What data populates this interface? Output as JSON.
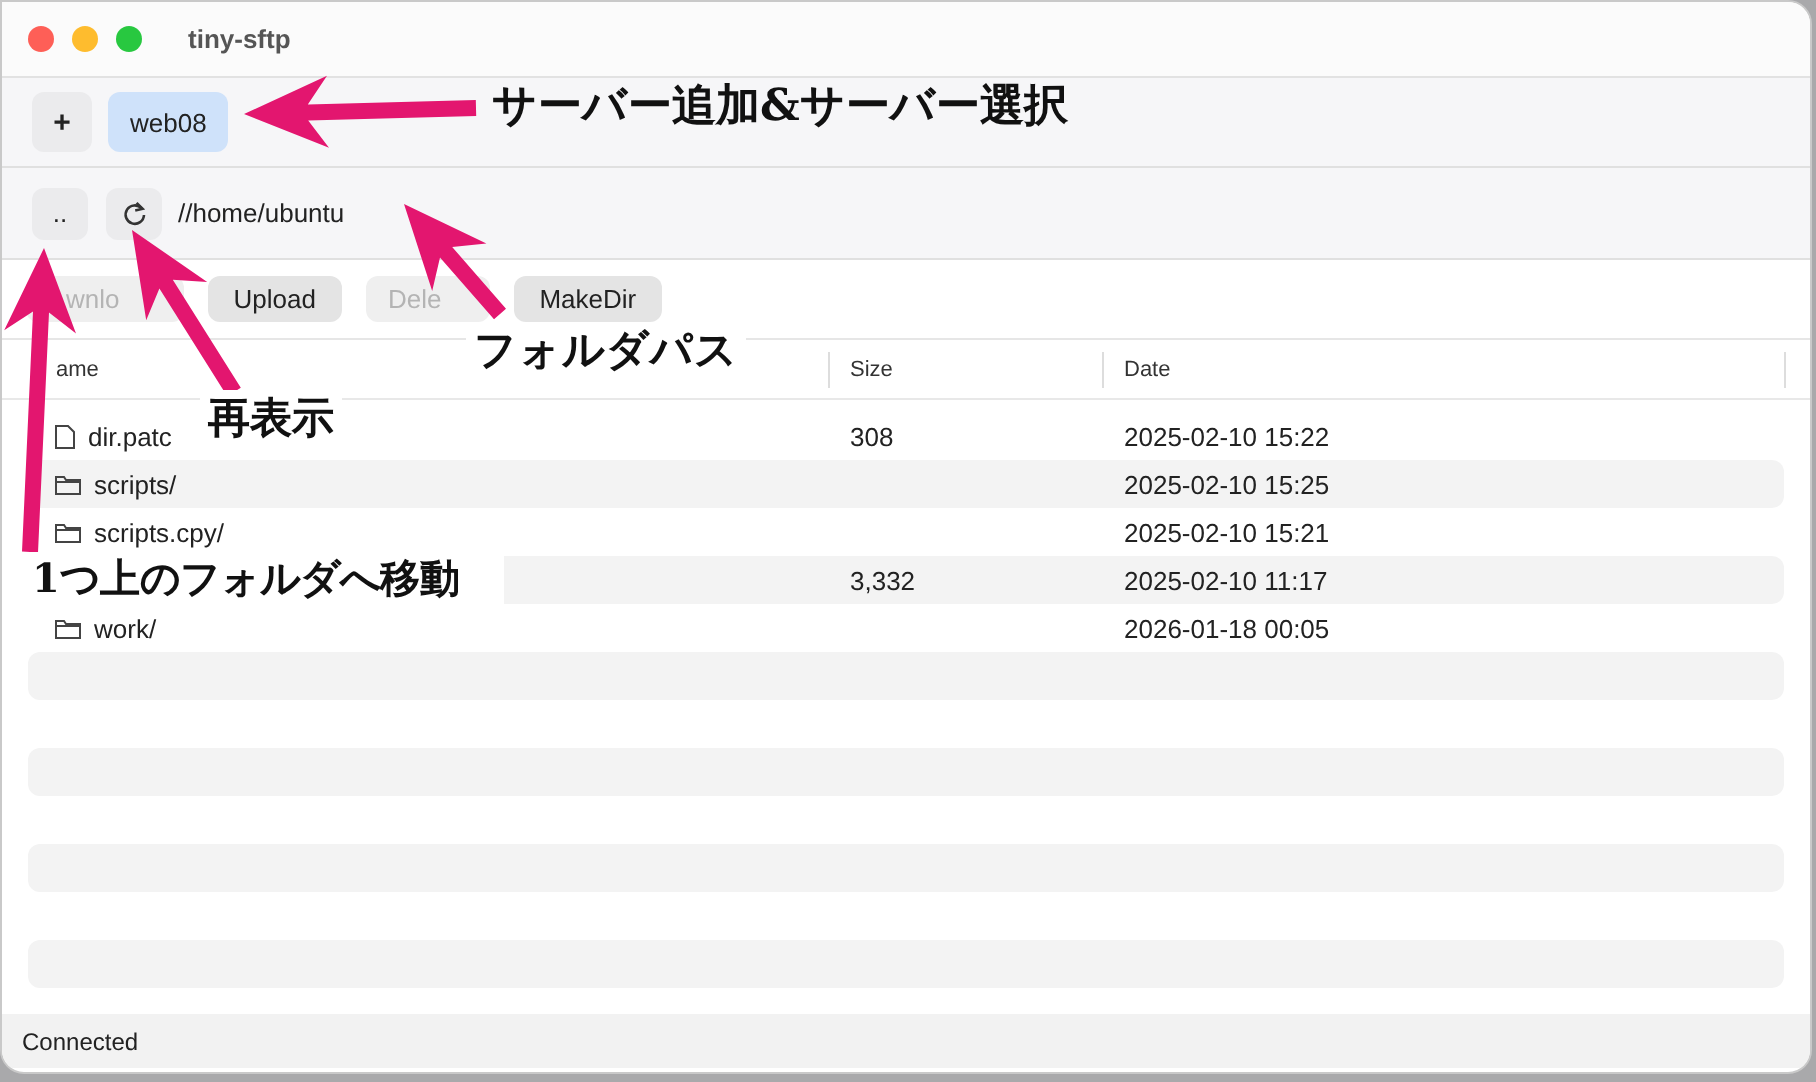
{
  "window": {
    "title": "tiny-sftp"
  },
  "servers": {
    "add_label": "+",
    "items": [
      {
        "label": "web08",
        "selected": true
      }
    ]
  },
  "path_bar": {
    "up_label": "..",
    "path": "//home/ubuntu"
  },
  "actions": [
    {
      "label": "wnlo",
      "disabled": true
    },
    {
      "label": "Upload",
      "disabled": false
    },
    {
      "label": "Dele",
      "disabled": true
    },
    {
      "label": "MakeDir",
      "disabled": false
    }
  ],
  "table": {
    "columns": [
      "ame",
      "Size",
      "Date"
    ],
    "rows": [
      {
        "kind": "file",
        "name": "dir.patc",
        "size": "308",
        "date": "2025-02-10 15:22"
      },
      {
        "kind": "folder",
        "name": "scripts/",
        "size": "",
        "date": "2025-02-10 15:25"
      },
      {
        "kind": "folder",
        "name": "scripts.cpy/",
        "size": "",
        "date": "2025-02-10 15:21"
      },
      {
        "size": "3,332",
        "date": "2025-02-10 11:17"
      },
      {
        "kind": "folder",
        "name": "work/",
        "size": "",
        "date": "2026-01-18 00:05"
      }
    ]
  },
  "status_bar": "Connected",
  "annotations": [
    "サーバー追加&サーバー選択",
    "フォルダパス",
    "再表示",
    "1つ上のフォルダへ移動"
  ]
}
